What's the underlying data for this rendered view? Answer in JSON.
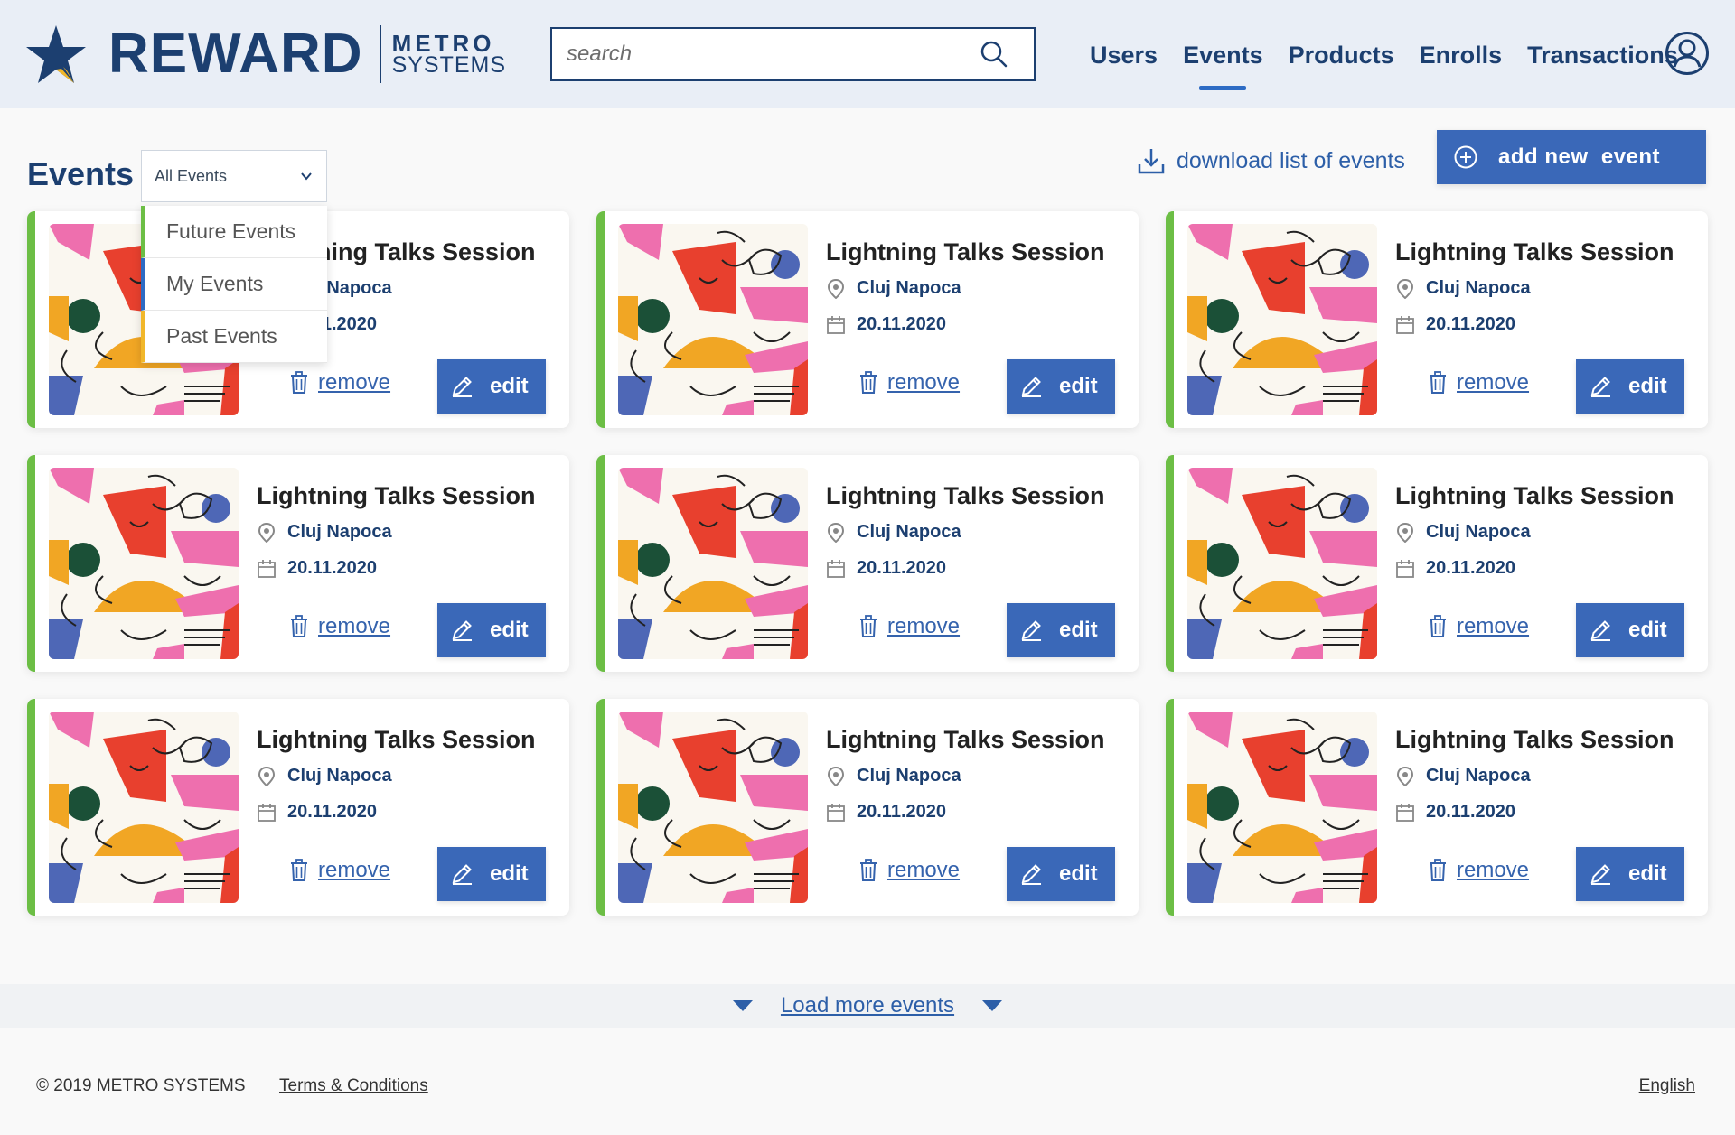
{
  "brand": {
    "name": "REWARD",
    "sub_line_1": "METRO",
    "sub_line_2": "SYSTEMS",
    "star_color": "#1c3f70",
    "accent_color": "#f1b72a"
  },
  "search": {
    "placeholder": "search"
  },
  "nav": {
    "items": [
      {
        "label": "Users",
        "active": false
      },
      {
        "label": "Events",
        "active": true
      },
      {
        "label": "Products",
        "active": false
      },
      {
        "label": "Enrolls",
        "active": false
      },
      {
        "label": "Transactions",
        "active": false
      }
    ]
  },
  "toolbar": {
    "title": "Events",
    "filter_value": "All Events",
    "download_label": "download list of events",
    "add_label": "add new  event"
  },
  "filter_dropdown": {
    "options": [
      "Future Events",
      "My Events",
      "Past Events"
    ]
  },
  "events": [
    {
      "title": "Lightning Talks Session",
      "location": "Cluj Napoca",
      "date": "20.11.2020"
    },
    {
      "title": "Lightning Talks Session",
      "location": "Cluj Napoca",
      "date": "20.11.2020"
    },
    {
      "title": "Lightning Talks Session",
      "location": "Cluj Napoca",
      "date": "20.11.2020"
    },
    {
      "title": "Lightning Talks Session",
      "location": "Cluj Napoca",
      "date": "20.11.2020"
    },
    {
      "title": "Lightning Talks Session",
      "location": "Cluj Napoca",
      "date": "20.11.2020"
    },
    {
      "title": "Lightning Talks Session",
      "location": "Cluj Napoca",
      "date": "20.11.2020"
    },
    {
      "title": "Lightning Talks Session",
      "location": "Cluj Napoca",
      "date": "20.11.2020"
    },
    {
      "title": "Lightning Talks Session",
      "location": "Cluj Napoca",
      "date": "20.11.2020"
    },
    {
      "title": "Lightning Talks Session",
      "location": "Cluj Napoca",
      "date": "20.11.2020"
    }
  ],
  "card_actions": {
    "remove_label": "remove",
    "edit_label": "edit"
  },
  "load_more": {
    "label": "Load more events"
  },
  "footer": {
    "copyright": "© 2019 METRO SYSTEMS",
    "terms": "Terms & Conditions",
    "language": "English"
  },
  "colors": {
    "primary": "#1c3f70",
    "button": "#3a68b8",
    "card_accent": "#6cbe45",
    "future": "#6cbe45",
    "mine": "#2d6bc4",
    "past": "#f1b72a"
  }
}
